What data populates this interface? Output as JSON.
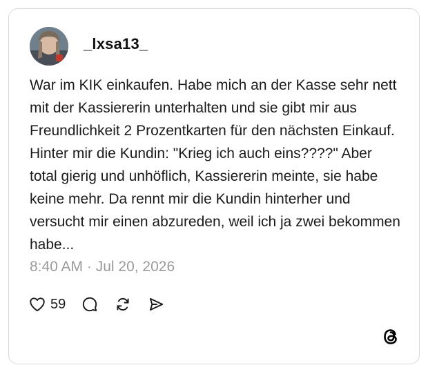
{
  "post": {
    "username": "_lxsa13_",
    "text": "War im KIK einkaufen. Habe mich an der Kasse sehr nett mit der Kassiererin unterhalten und sie gibt mir aus Freundlichkeit 2 Prozentkarten für den nächsten Einkauf. Hinter mir die Kundin: \"Krieg ich auch eins????\" Aber total gierig und unhöflich, Kassiererin meinte, sie habe keine mehr. Da rennt mir die Kundin hinterher und versucht mir einen abzureden, weil ich ja zwei bekommen habe...",
    "timestamp": "8:40 AM · Jul 20, 2026",
    "like_count": "59"
  },
  "icons": {
    "like": "heart-icon",
    "reply": "comment-icon",
    "repost": "repost-icon",
    "share": "send-icon",
    "brand": "threads-logo-icon"
  },
  "colors": {
    "text": "#1a1a1a",
    "muted": "#9a9a9a",
    "border": "#d9d9d9"
  }
}
